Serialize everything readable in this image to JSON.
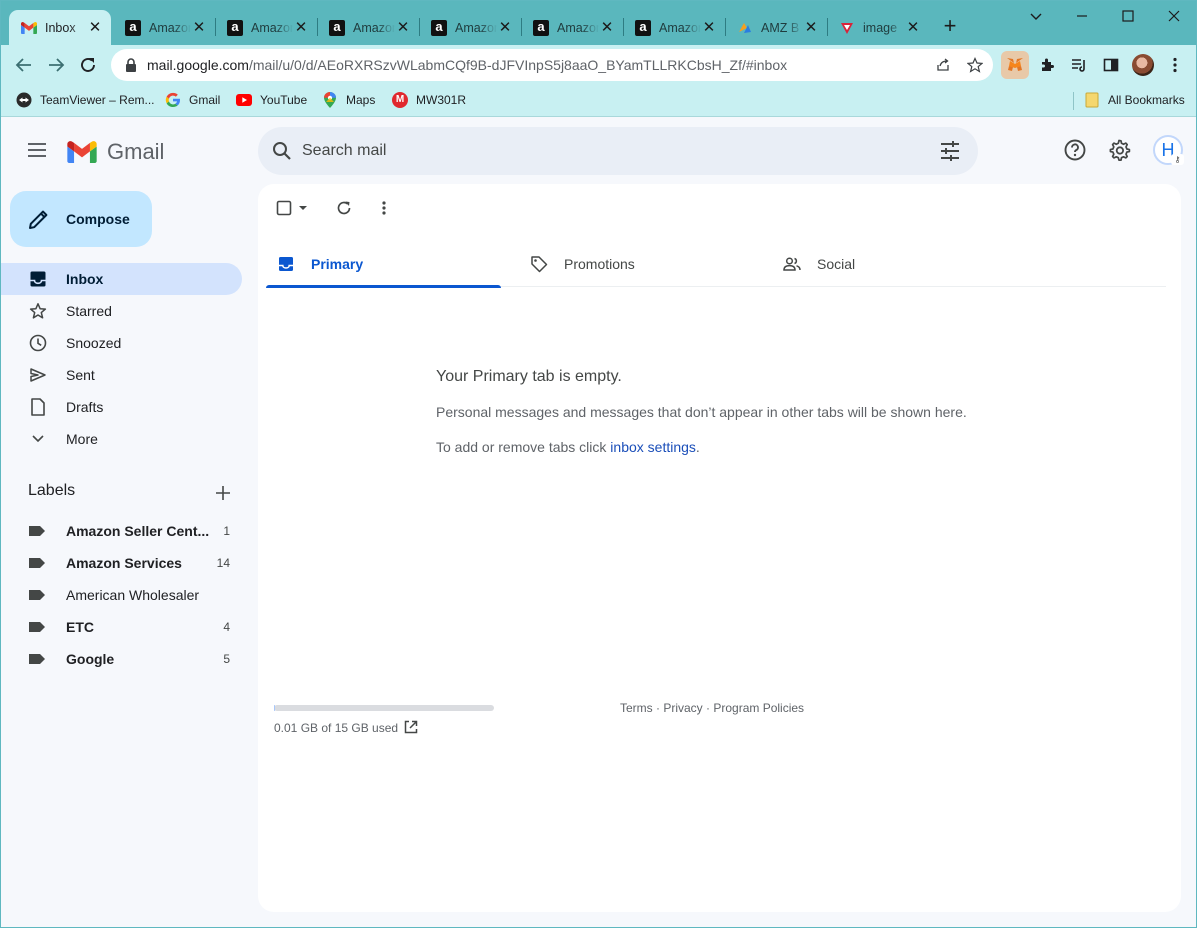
{
  "browser": {
    "tabs": [
      {
        "title": "Inbox",
        "icon": "gmail-icon",
        "active": true
      },
      {
        "title": "Amazon",
        "icon": "amazon-icon",
        "active": false
      },
      {
        "title": "Amazon",
        "icon": "amazon-icon",
        "active": false
      },
      {
        "title": "Amazon",
        "icon": "amazon-icon",
        "active": false
      },
      {
        "title": "Amazon",
        "icon": "amazon-icon",
        "active": false
      },
      {
        "title": "Amazon",
        "icon": "amazon-icon",
        "active": false
      },
      {
        "title": "Amazon",
        "icon": "amazon-icon",
        "active": false
      },
      {
        "title": "AMZ B",
        "icon": "amz-icon",
        "active": false
      },
      {
        "title": "image",
        "icon": "image-icon",
        "active": false
      }
    ],
    "new_tab": "+",
    "url_domain": "mail.google.com",
    "url_path": "/mail/u/0/d/AEoRXRSzvWLabmCQf9B-dJFVInpS5j8aaO_BYamTLLRKCbsH_Zf/#inbox",
    "bookmarks": [
      {
        "label": "TeamViewer – Rem...",
        "icon": "teamviewer-icon"
      },
      {
        "label": "Gmail",
        "icon": "google-icon"
      },
      {
        "label": "YouTube",
        "icon": "youtube-icon"
      },
      {
        "label": "Maps",
        "icon": "maps-icon"
      },
      {
        "label": "MW301R",
        "icon": "mw-icon"
      }
    ],
    "all_bookmarks": "All Bookmarks"
  },
  "gmail": {
    "logo_text": "Gmail",
    "search_placeholder": "Search mail",
    "avatar_initial": "H",
    "compose_label": "Compose",
    "nav": [
      {
        "label": "Inbox",
        "icon": "inbox-icon",
        "active": true
      },
      {
        "label": "Starred",
        "icon": "star-icon",
        "active": false
      },
      {
        "label": "Snoozed",
        "icon": "clock-icon",
        "active": false
      },
      {
        "label": "Sent",
        "icon": "send-icon",
        "active": false
      },
      {
        "label": "Drafts",
        "icon": "draft-icon",
        "active": false
      },
      {
        "label": "More",
        "icon": "chevron-down-icon",
        "active": false
      }
    ],
    "labels_title": "Labels",
    "labels": [
      {
        "name": "Amazon Seller Cent...",
        "count": "1",
        "bold": true
      },
      {
        "name": "Amazon Services",
        "count": "14",
        "bold": true
      },
      {
        "name": "American Wholesaler",
        "count": "",
        "bold": false
      },
      {
        "name": "ETC",
        "count": "4",
        "bold": true
      },
      {
        "name": "Google",
        "count": "5",
        "bold": true
      }
    ],
    "category_tabs": [
      {
        "label": "Primary",
        "icon": "inbox-tab-icon",
        "active": true
      },
      {
        "label": "Promotions",
        "icon": "tag-icon",
        "active": false
      },
      {
        "label": "Social",
        "icon": "people-icon",
        "active": false
      }
    ],
    "empty_title": "Your Primary tab is empty.",
    "empty_desc": "Personal messages and messages that don’t appear in other tabs will be shown here.",
    "empty_add_prefix": "To add or remove tabs click ",
    "empty_add_link": "inbox settings",
    "empty_add_suffix": ".",
    "storage_text": "0.01 GB of 15 GB used",
    "storage_used_fraction": 0.0007,
    "footer_terms": "Terms",
    "footer_privacy": "Privacy",
    "footer_policies": "Program Policies",
    "footer_sep": " · "
  }
}
